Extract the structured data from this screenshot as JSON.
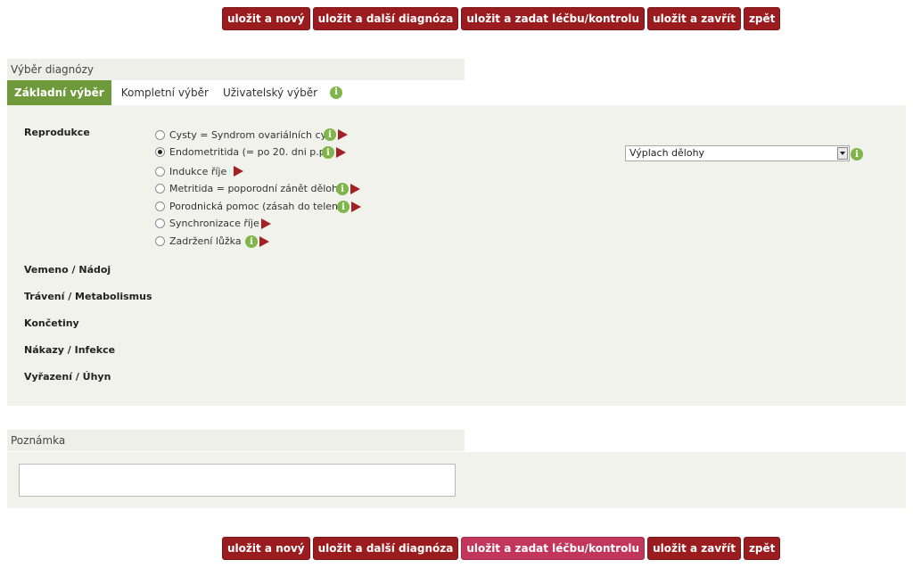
{
  "buttons": {
    "save_new": "uložit a nový",
    "save_next_diag": "uložit a další diagnóza",
    "save_treatment": "uložit a zadat léčbu/kontrolu",
    "save_close": "uložit a zavřít",
    "back": "zpět"
  },
  "diagnosis_section": {
    "title": "Výběr diagnózy",
    "tabs": [
      "Základní výběr",
      "Kompletní výběr",
      "Uživatelský výběr"
    ],
    "active_tab": "Základní výběr"
  },
  "categories": [
    "Reprodukce",
    "Vemeno / Nádoj",
    "Trávení / Metabolismus",
    "Končetiny",
    "Nákazy / Infekce",
    "Vyřazení / Úhyn"
  ],
  "reproduction_options": [
    {
      "label": "Cysty = Syndrom ovariálních cyst",
      "selected": false
    },
    {
      "label": "Endometritida (= po 20. dni p.p.)",
      "selected": true
    },
    {
      "label": "Indukce říje",
      "selected": false
    },
    {
      "label": "Metritida = poporodní zánět dělohy",
      "selected": false
    },
    {
      "label": "Porodnická pomoc (zásah do telení)",
      "selected": false
    },
    {
      "label": "Synchronizace říje",
      "selected": false
    },
    {
      "label": "Zadržení lůžka",
      "selected": false
    }
  ],
  "treatment_select": {
    "value": "Výplach dělohy"
  },
  "note_section": {
    "title": "Poznámka",
    "value": ""
  },
  "colors": {
    "button": "#9b1c1f",
    "button_highlight": "#c2365c",
    "active_tab": "#6f9a3c",
    "info_icon": "#7fb54b"
  }
}
